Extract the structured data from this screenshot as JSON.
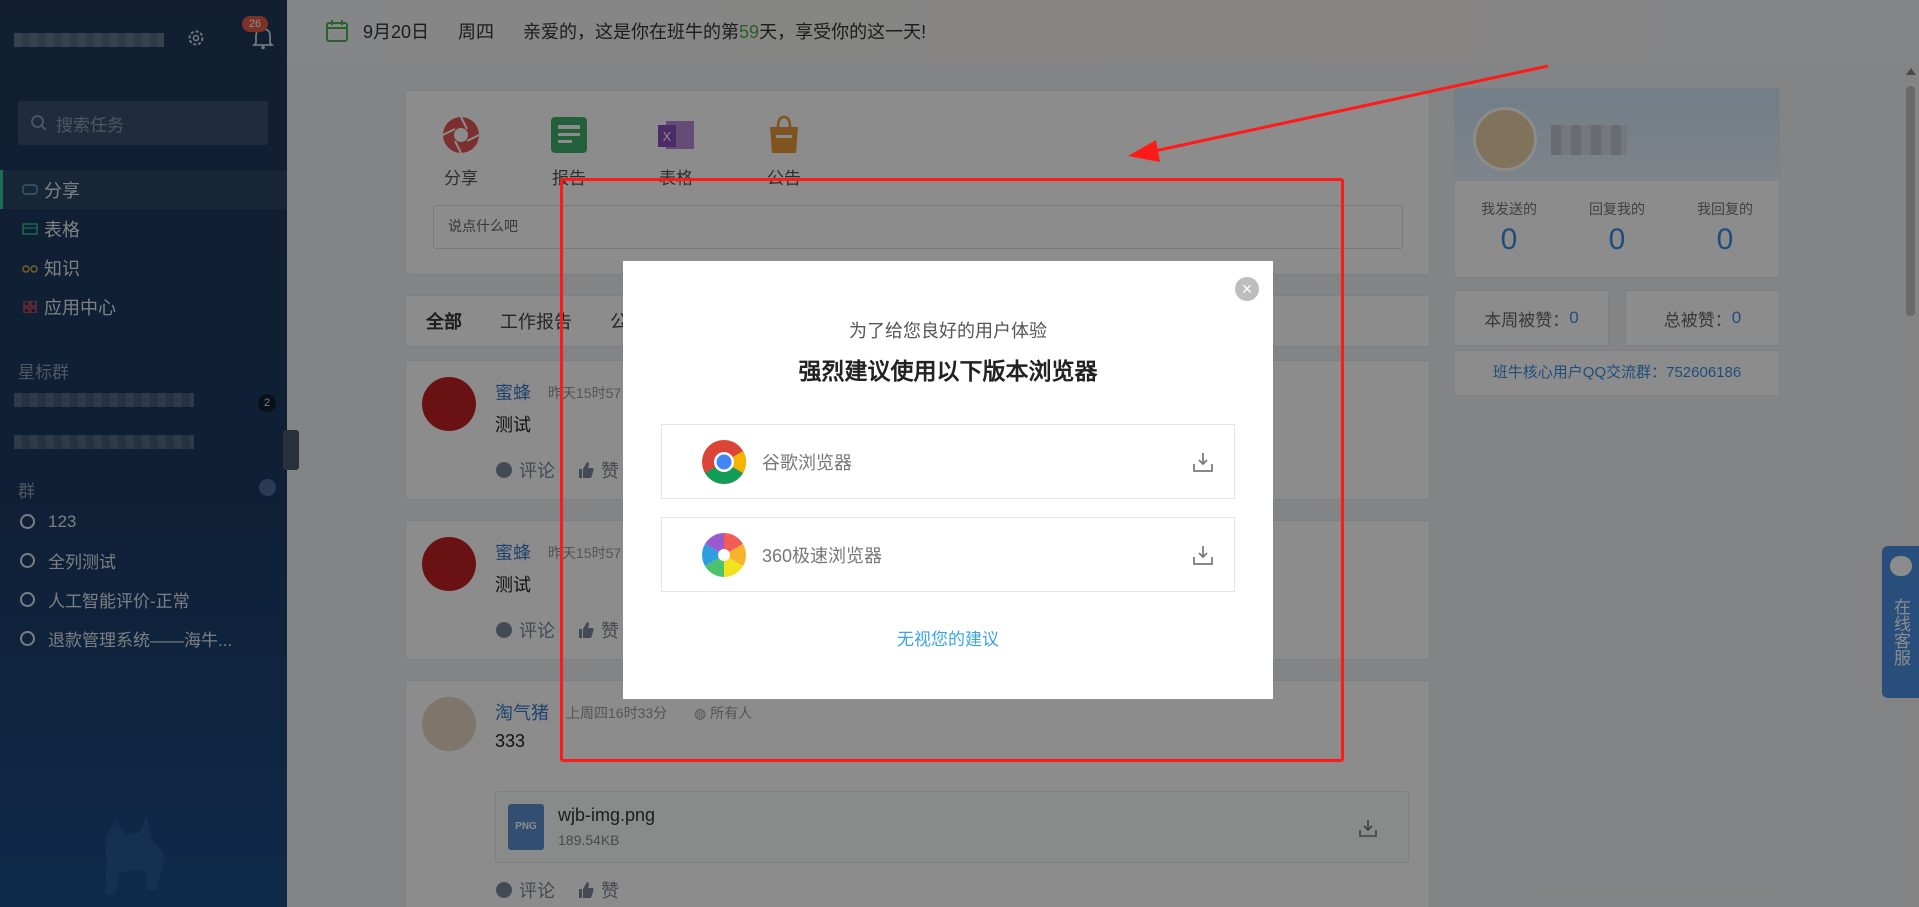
{
  "sidebar": {
    "badge_count": "26",
    "search_placeholder": "搜索任务",
    "nav": [
      "分享",
      "表格",
      "知识",
      "应用中心"
    ],
    "starred_title": "星标群",
    "starred_count": "2",
    "group_title": "群",
    "groups": [
      "123",
      "全列测试",
      "人工智能评价-正常",
      "退款管理系统——海牛..."
    ]
  },
  "topbar": {
    "date": "9月20日",
    "weekday": "周四",
    "greeting_prefix": "亲爱的，这是你在班牛的第",
    "days": "59",
    "greeting_suffix": "天，享受你的这一天!"
  },
  "composer": {
    "tools": [
      "分享",
      "报告",
      "表格",
      "公告"
    ],
    "placeholder": "说点什么吧"
  },
  "tabs": [
    "全部",
    "工作报告",
    "公"
  ],
  "posts": [
    {
      "author": "蜜蜂",
      "meta": "昨天15时57",
      "body": "测试",
      "comment": "评论",
      "like": "赞"
    },
    {
      "author": "蜜蜂",
      "meta": "昨天15时57",
      "body": "测试",
      "comment": "评论",
      "like": "赞"
    },
    {
      "author": "淘气猪",
      "meta": "上周四16时33分",
      "scope": "所有人",
      "body": "333",
      "comment": "评论",
      "like": "赞",
      "attachment": {
        "type": "PNG",
        "name": "wjb-img.png",
        "size": "189.54KB"
      }
    }
  ],
  "profile": {
    "stats": [
      {
        "label": "我发送的",
        "value": "0"
      },
      {
        "label": "回复我的",
        "value": "0"
      },
      {
        "label": "我回复的",
        "value": "0"
      }
    ],
    "week_likes_label": "本周被赞：",
    "week_likes": "0",
    "total_likes_label": "总被赞：",
    "total_likes": "0",
    "qq_group": "班牛核心用户QQ交流群：752606186"
  },
  "support": "在线客服",
  "modal": {
    "subtitle": "为了给您良好的用户体验",
    "title": "强烈建议使用以下版本浏览器",
    "browsers": [
      "谷歌浏览器",
      "360极速浏览器"
    ],
    "ignore": "无视您的建议",
    "close_glyph": "×"
  },
  "colors": {
    "sidebar": "#1c3a63",
    "accent_blue": "#3a8de0",
    "annotation_red": "#ff1a1a",
    "days_highlight": "#4caf50"
  }
}
